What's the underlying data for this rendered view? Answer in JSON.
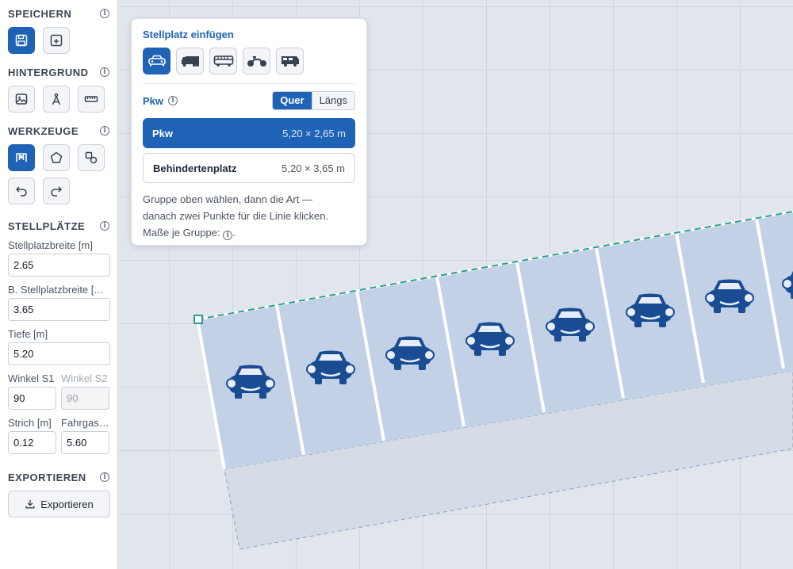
{
  "sidebar": {
    "save": {
      "title": "SPEICHERN",
      "buttons": [
        {
          "icon": "save-icon",
          "active": true
        },
        {
          "icon": "save-as-icon",
          "active": false
        }
      ]
    },
    "background": {
      "title": "HINTERGRUND",
      "buttons": [
        {
          "icon": "image-icon"
        },
        {
          "icon": "compass-icon"
        },
        {
          "icon": "ruler-icon"
        }
      ]
    },
    "tools": {
      "title": "WERKZEUGE",
      "buttons": [
        {
          "icon": "parking-row-icon",
          "active": true
        },
        {
          "icon": "polygon-icon"
        },
        {
          "icon": "shapes-icon"
        },
        {
          "icon": "undo-icon"
        },
        {
          "icon": "redo-icon"
        }
      ]
    },
    "spaces": {
      "title": "STELLPLÄTZE",
      "width_label": "Stellplatzbreite [m]",
      "width_value": "2.65",
      "disabled_width_label": "B. Stellplatzbreite [...",
      "disabled_width_value": "3.65",
      "depth_label": "Tiefe [m]",
      "depth_value": "5.20",
      "angle1_label": "Winkel S1",
      "angle1_value": "90",
      "angle2_label": "Winkel S2",
      "angle2_value": "90",
      "line_label": "Strich [m]",
      "line_value": "0.12",
      "aisle_label": "Fahrgasse",
      "aisle_value": "5.60"
    },
    "export": {
      "title": "EXPORTIEREN",
      "button_label": "Exportieren"
    }
  },
  "popup": {
    "title": "Stellplatz einfügen",
    "vehicle_types": [
      "car-icon",
      "truck-icon",
      "bus-icon",
      "motorcycle-icon",
      "camper-icon"
    ],
    "group_label": "Pkw",
    "orientation": {
      "active": "Quer",
      "inactive": "Längs"
    },
    "options": [
      {
        "name": "Pkw",
        "dims": "5,20 × 2,65 m",
        "selected": true
      },
      {
        "name": "Behindertenplatz",
        "dims": "5,20 × 3,65 m",
        "selected": false
      }
    ],
    "help_line1": "Gruppe oben wählen, dann die Art —",
    "help_line2": "danach zwei Punkte für die Linie klicken.",
    "help_line3": "Maße je Gruppe:",
    "help_line3_end": "."
  },
  "colors": {
    "accent": "#1e63b6",
    "stall_fill": "#c3d1e6",
    "car": "#1a4c93",
    "dash_line": "#2a9d8f"
  }
}
